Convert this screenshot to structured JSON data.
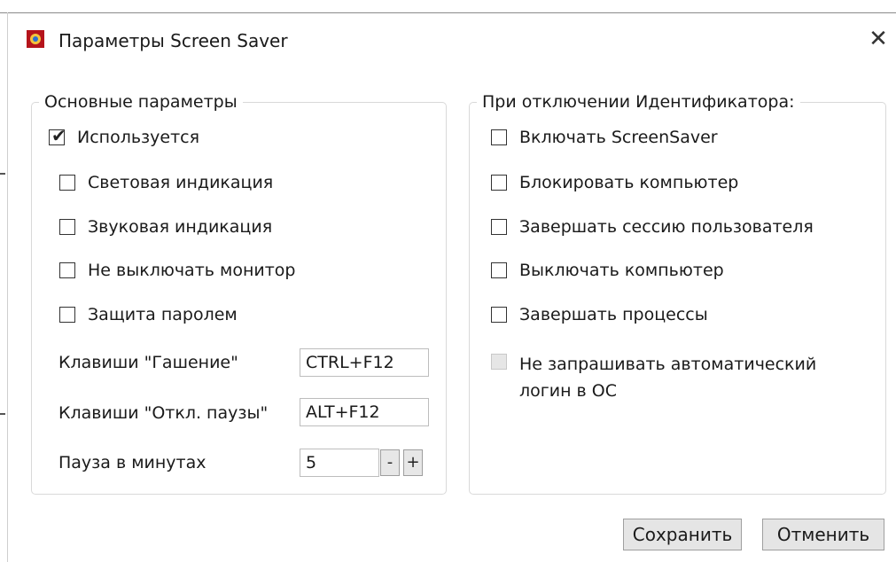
{
  "window": {
    "title": "Параметры Screen Saver",
    "close_glyph": "✕"
  },
  "main_group": {
    "legend": "Основные параметры",
    "used": {
      "label": "Используется",
      "checked": true
    },
    "options": [
      {
        "label": "Световая индикация",
        "checked": false
      },
      {
        "label": "Звуковая индикация",
        "checked": false
      },
      {
        "label": "Не выключать монитор",
        "checked": false
      },
      {
        "label": "Защита паролем",
        "checked": false
      }
    ],
    "blank_keys": {
      "label": "Клавиши \"Гашение\"",
      "value": "CTRL+F12"
    },
    "unpause_keys": {
      "label": "Клавиши \"Откл. паузы\"",
      "value": "ALT+F12"
    },
    "pause": {
      "label": "Пауза в минутах",
      "value": "5",
      "minus": "-",
      "plus": "+"
    }
  },
  "disconnect_group": {
    "legend": "При отключении Идентификатора:",
    "options": [
      {
        "label": "Включать ScreenSaver",
        "checked": false
      },
      {
        "label": "Блокировать компьютер",
        "checked": false
      },
      {
        "label": "Завершать сессию пользователя",
        "checked": false
      },
      {
        "label": "Выключать компьютер",
        "checked": false
      },
      {
        "label": "Завершать процессы",
        "checked": false
      }
    ],
    "disabled_option": {
      "line1": "Не запрашивать автоматический",
      "line2": "логин в ОС",
      "checked": false,
      "enabled": false
    }
  },
  "buttons": {
    "save": "Сохранить",
    "cancel": "Отменить"
  },
  "icons": {
    "app": "app-shield-icon",
    "close": "close-icon",
    "check": "checkmark-icon"
  }
}
